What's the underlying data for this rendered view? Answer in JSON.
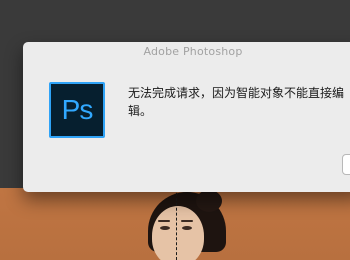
{
  "dialog": {
    "title": "Adobe Photoshop",
    "app_icon_label": "Ps",
    "message": "无法完成请求，因为智能对象不能直接编辑。",
    "ok_label": ""
  },
  "colors": {
    "background_dark": "#3a3a3a",
    "photo_backdrop": "#c77a46",
    "dialog_bg": "#ececec",
    "ps_icon_bg": "#061f2f",
    "ps_icon_accent": "#31a8ff"
  },
  "icons": {
    "app_icon": "photoshop-app-icon"
  }
}
